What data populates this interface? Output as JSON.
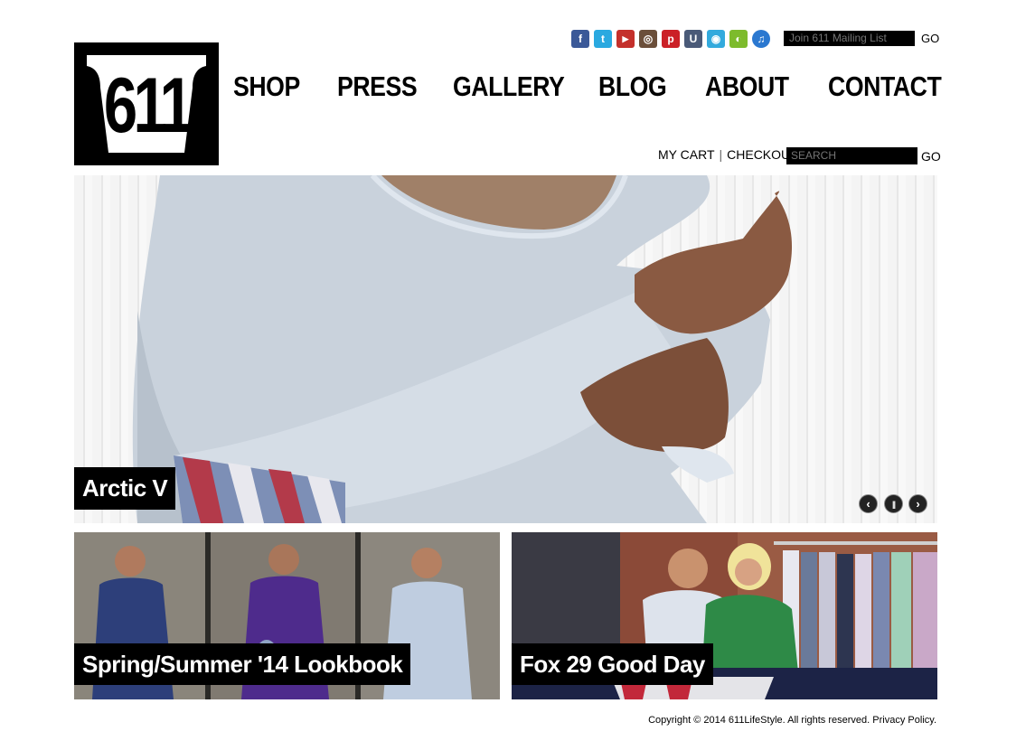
{
  "logo": {
    "text": "611"
  },
  "social": [
    {
      "icon": "facebook-icon",
      "glyph": "f",
      "color": "#3b5998"
    },
    {
      "icon": "twitter-icon",
      "glyph": "t",
      "color": "#2aa9e0"
    },
    {
      "icon": "youtube-icon",
      "glyph": "▶",
      "color": "#c4302b"
    },
    {
      "icon": "instagram-icon",
      "glyph": "◎",
      "color": "#6b4f3a"
    },
    {
      "icon": "pinterest-icon",
      "glyph": "p",
      "color": "#cb2027"
    },
    {
      "icon": "ustream-icon",
      "glyph": "U",
      "color": "#4a5a78"
    },
    {
      "icon": "circle-app-icon",
      "glyph": "◉",
      "color": "#33aadd"
    },
    {
      "icon": "podcast-icon",
      "glyph": "◐",
      "color": "#7dbb2c"
    },
    {
      "icon": "itunes-icon",
      "glyph": "♫",
      "color": "#2b78d0"
    }
  ],
  "mailing": {
    "placeholder": "Join 611 Mailing List",
    "go": "GO"
  },
  "nav": {
    "shop": "SHOP",
    "press": "PRESS",
    "gallery": "GALLERY",
    "blog": "BLOG",
    "about": "ABOUT",
    "contact": "CONTACT"
  },
  "cart": {
    "my_cart": "MY CART",
    "sep": "|",
    "checkout": "CHECKOUT"
  },
  "search": {
    "placeholder": "SEARCH",
    "go": "GO"
  },
  "hero": {
    "caption": "Arctic V",
    "prev": "‹",
    "pause": "||",
    "next": "›"
  },
  "tiles": [
    {
      "caption": "Spring/Summer '14 Lookbook"
    },
    {
      "caption": "Fox 29 Good Day"
    }
  ],
  "footer": {
    "copyright": "Copyright © 2014 611LifeStyle. All rights reserved.",
    "privacy": "Privacy Policy."
  }
}
